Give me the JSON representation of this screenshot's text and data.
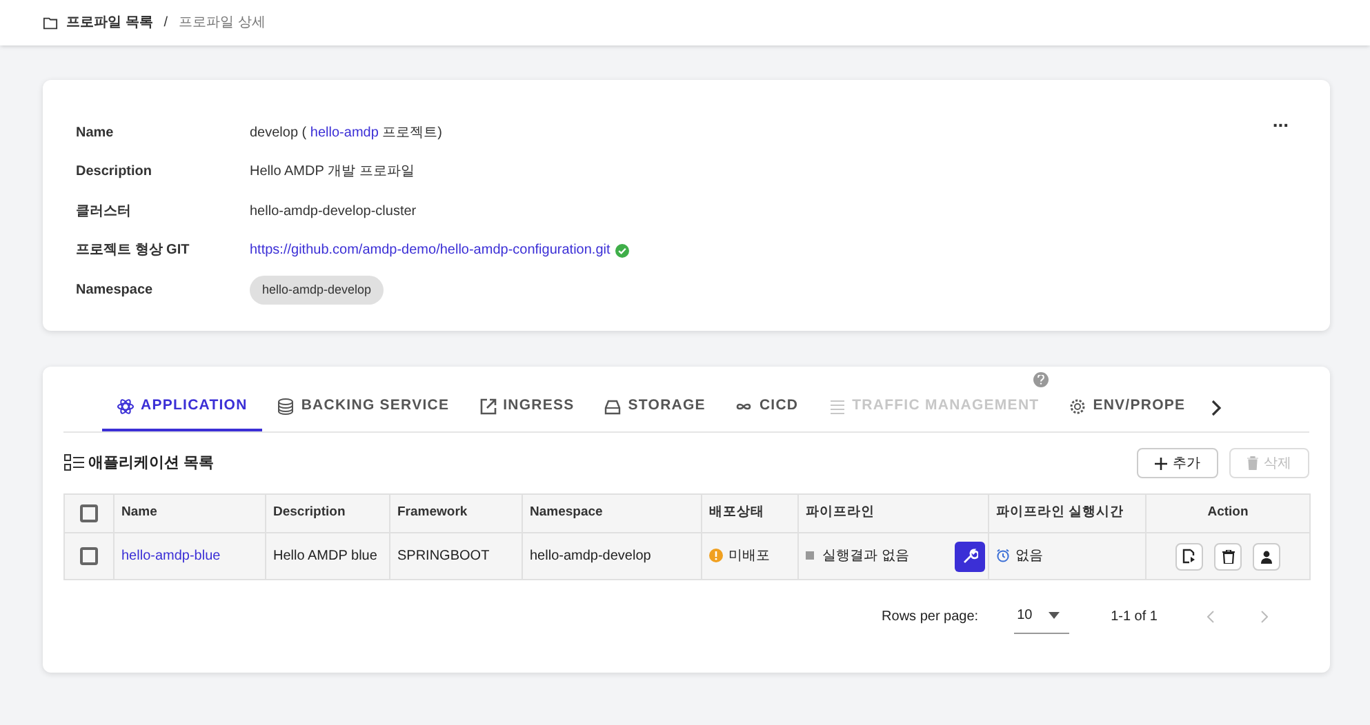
{
  "breadcrumb": {
    "items": [
      "프로파일 목록",
      "프로파일 상세"
    ],
    "separator": "/"
  },
  "profile": {
    "menu": "...",
    "fields": [
      {
        "label": "Name",
        "kind": "name",
        "value": "develop ( **hello-amdp** 프로젝트)"
      },
      {
        "label": "Description",
        "kind": "text",
        "value": "Hello AMDP 개발 프로파일"
      },
      {
        "label": "클러스터",
        "kind": "text",
        "value": "hello-amdp-develop-cluster"
      },
      {
        "label": "프로젝트 형상 GIT",
        "kind": "link",
        "value": "https://github.com/amdp-demo/hello-amdp-configuration.git",
        "verified": true
      },
      {
        "label": "Namespace",
        "kind": "chip",
        "value": "hello-amdp-develop"
      }
    ]
  },
  "tabs": [
    {
      "label": "APPLICATION",
      "selected": true,
      "disabled": false,
      "help": false
    },
    {
      "label": "BACKING SERVICE",
      "selected": false,
      "disabled": false,
      "help": false
    },
    {
      "label": "INGRESS",
      "selected": false,
      "disabled": false,
      "help": false
    },
    {
      "label": "STORAGE",
      "selected": false,
      "disabled": false,
      "help": false
    },
    {
      "label": "CICD",
      "selected": false,
      "disabled": false,
      "help": false
    },
    {
      "label": "TRAFFIC MANAGEMENT",
      "selected": false,
      "disabled": true,
      "help": true
    },
    {
      "label": "ENV/PROPE",
      "selected": false,
      "disabled": false,
      "help": false
    }
  ],
  "list": {
    "title": "애플리케이션 목록",
    "add_button": "추가",
    "delete_button": {
      "label": "삭제",
      "disabled": true
    }
  },
  "table": {
    "columns": [
      "Name",
      "Description",
      "Framework",
      "Namespace",
      "배포상태",
      "파이프라인",
      "파이프라인 실행시간",
      "Action"
    ],
    "all_checked": false,
    "rows": [
      {
        "checked": false,
        "name": "hello-amdp-blue",
        "description": "Hello AMDP blue",
        "framework": "SPRINGBOOT",
        "namespace": "hello-amdp-develop",
        "deploy_status": "미배포",
        "pipeline": "실행결과 없음",
        "run_time": "없음"
      }
    ]
  },
  "pagination": {
    "rows_per_page_label": "Rows per page:",
    "rows_per_page": "10",
    "range": "1-1 of 1"
  }
}
